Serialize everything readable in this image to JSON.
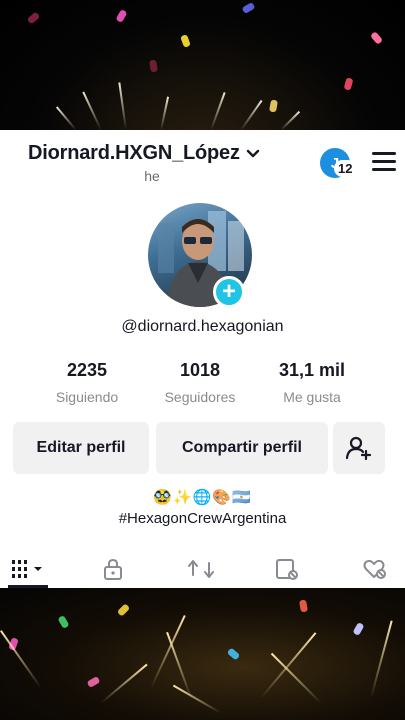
{
  "header": {
    "username": "Diornard.HXGN_López",
    "subname": "he",
    "notification_initial": "J",
    "notification_count": "12"
  },
  "profile": {
    "handle": "@diornard.hexagonian",
    "emojis": "🥸✨🌐🎨🇦🇷",
    "bio": "#HexagonCrewArgentina"
  },
  "stats": [
    {
      "value": "2235",
      "label": "Siguiendo"
    },
    {
      "value": "1018",
      "label": "Seguidores"
    },
    {
      "value": "31,1 mil",
      "label": "Me gusta"
    }
  ],
  "buttons": {
    "edit_profile": "Editar perfil",
    "share_profile": "Compartir perfil"
  },
  "colors": {
    "accent": "#20c5e6",
    "notification": "#1d8fe0",
    "button_bg": "#f1f1f2",
    "text": "#161823",
    "muted": "#8a8b91"
  },
  "icons": [
    "chevron-down-icon",
    "menu-icon",
    "add-avatar-icon",
    "add-friend-icon",
    "grid-icon",
    "lock-icon",
    "repost-icon",
    "tagged-icon",
    "liked-icon"
  ]
}
